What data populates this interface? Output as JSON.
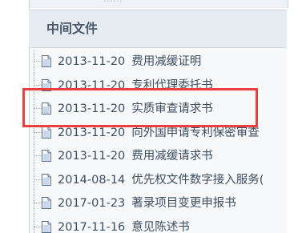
{
  "panel": {
    "title": "中间文件",
    "above_text": "……"
  },
  "files": [
    {
      "date": "2013-11-20",
      "name": "费用减缓证明"
    },
    {
      "date": "2013-11-20",
      "name": "专利代理委托书"
    },
    {
      "date": "2013-11-20",
      "name": "实质审查请求书"
    },
    {
      "date": "2013-11-20",
      "name": "向外国申请专利保密审查"
    },
    {
      "date": "2013-11-20",
      "name": "费用减缓请求书"
    },
    {
      "date": "2014-08-14",
      "name": "优先权文件数字接入服务("
    },
    {
      "date": "2017-01-23",
      "name": "著录项目变更申报书"
    },
    {
      "date": "2017-11-16",
      "name": "意见陈述书"
    }
  ],
  "colors": {
    "highlight": "#e8403f",
    "text": "#3d4d60",
    "header_bg": "#e7ecf2"
  },
  "icons": {
    "file": "document-icon"
  }
}
